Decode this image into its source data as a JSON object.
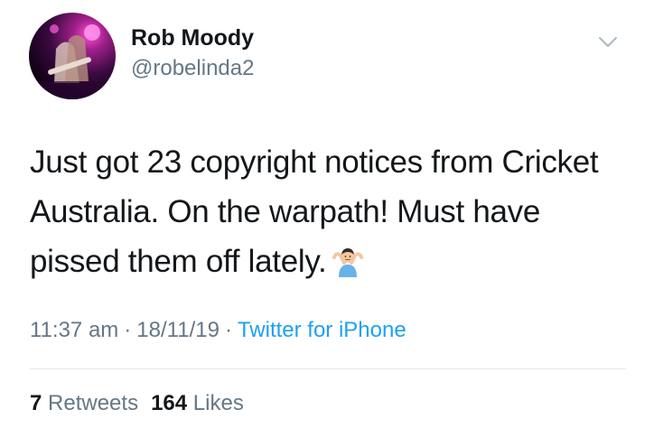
{
  "user": {
    "name": "Rob Moody",
    "handle": "@robelinda2"
  },
  "tweet": {
    "text": "Just got 23 copyright notices from Cricket Australia. On the warpath! Must have pissed them off lately.",
    "emoji": "man-shrugging-emoji"
  },
  "meta": {
    "time": "11:37 am",
    "dot1": "·",
    "date": "18/11/19",
    "dot2": "·",
    "source": "Twitter for iPhone"
  },
  "stats": {
    "retweets_count": "7",
    "retweets_label": "Retweets",
    "likes_count": "164",
    "likes_label": "Likes"
  },
  "icons": {
    "menu": "chevron-down-icon"
  },
  "colors": {
    "text": "#14171a",
    "secondary": "#657786",
    "link": "#1da1f2",
    "divider": "#e1e8ed"
  }
}
